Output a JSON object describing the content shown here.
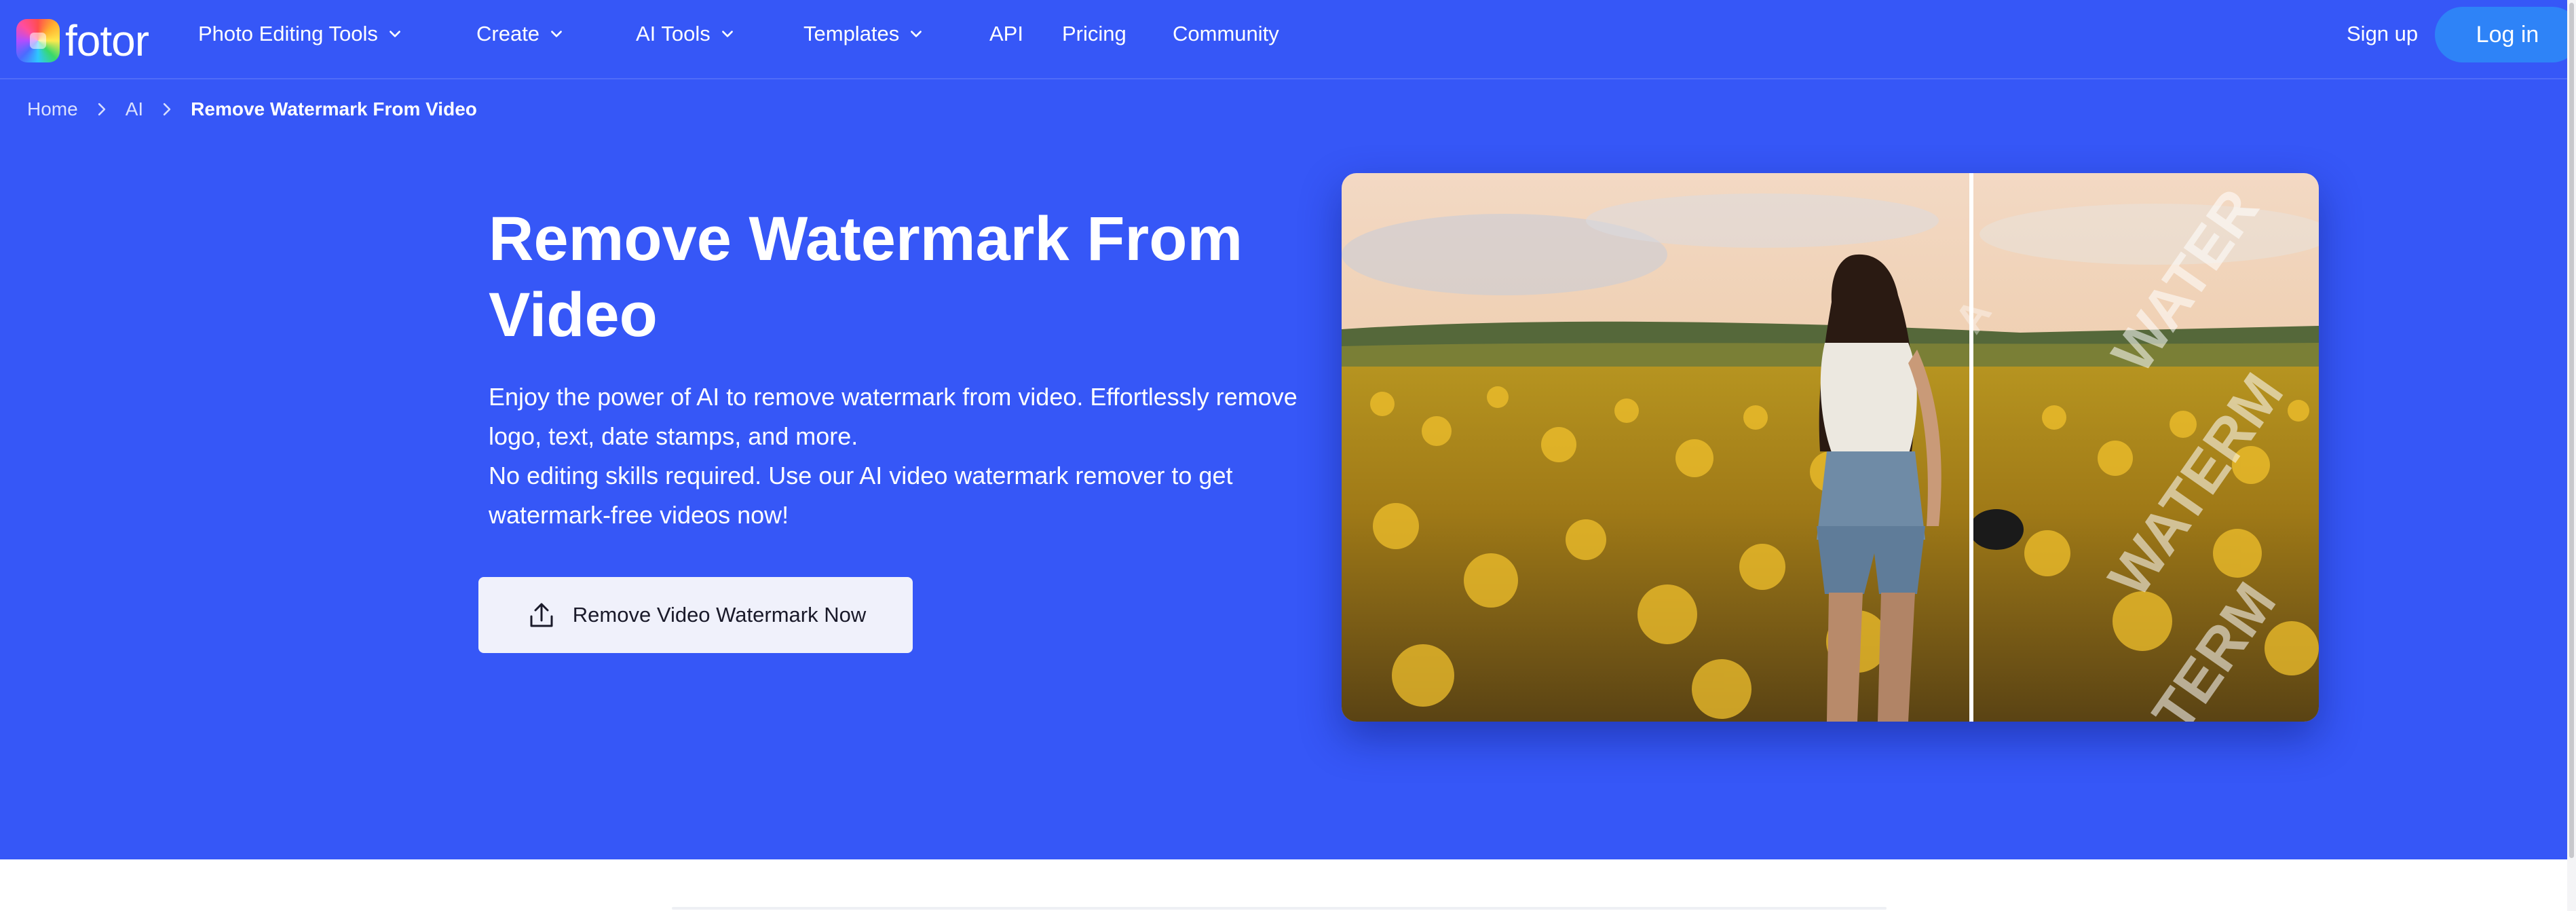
{
  "brand": {
    "name": "fotor",
    "logo_icon": "fotor-logo-icon"
  },
  "nav": {
    "items": [
      {
        "label": "Photo Editing Tools",
        "dropdown": true
      },
      {
        "label": "Create",
        "dropdown": true
      },
      {
        "label": "AI Tools",
        "dropdown": true
      },
      {
        "label": "Templates",
        "dropdown": true
      },
      {
        "label": "API",
        "dropdown": false
      },
      {
        "label": "Pricing",
        "dropdown": false
      },
      {
        "label": "Community",
        "dropdown": false
      }
    ],
    "signup": "Sign up",
    "login": "Log in"
  },
  "breadcrumb": {
    "items": [
      "Home",
      "AI"
    ],
    "current": "Remove Watermark From Video"
  },
  "hero": {
    "title": "Remove Watermark From Video",
    "desc_line1": "Enjoy the power of AI to remove watermark from video. Effortlessly remove logo, text, date stamps, and more.",
    "desc_line2": "No editing skills required. Use our AI video watermark remover to get watermark-free videos now!",
    "cta_label": "Remove Video Watermark Now",
    "cta_icon": "upload-icon"
  },
  "colors": {
    "hero_bg": "#3657f7",
    "login_bg": "#2e83f7",
    "cta_bg": "#f0f1fb"
  },
  "compare_image": {
    "icon": "before-after-photo",
    "watermark_texts": [
      "WATER",
      "WATERM",
      "WATERMA",
      "TERM",
      "A"
    ]
  }
}
